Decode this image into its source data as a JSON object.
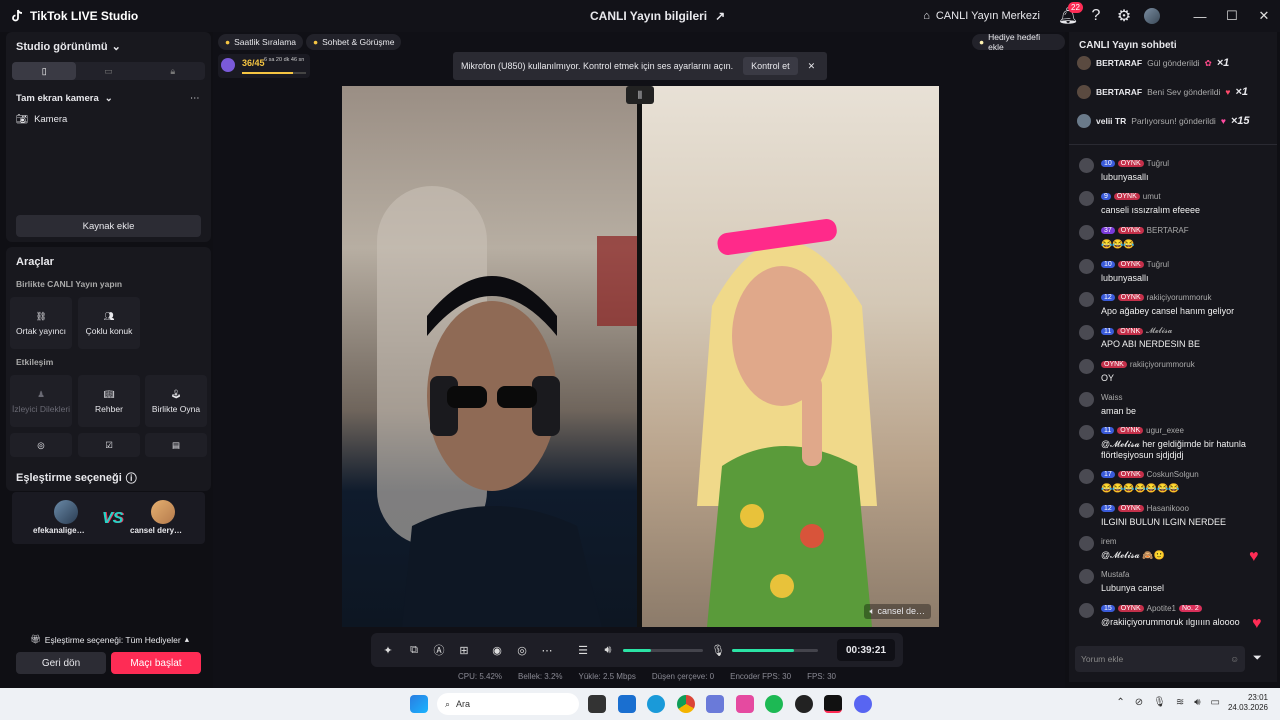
{
  "app": {
    "title": "TikTok LIVE Studio",
    "center_title": "CANLI Yayın bilgileri",
    "hub": "CANLI Yayın Merkezi",
    "notif_count": "22"
  },
  "left": {
    "studio_view": "Studio görünümü",
    "fullscreen_cam": "Tam ekran kamera",
    "camera": "Kamera",
    "add_source": "Kaynak ekle",
    "tools": "Araçlar",
    "live_together": "Birlikte CANLI Yayın yapın",
    "co_host": "Ortak yayıncı",
    "multi_guest": "Çoklu konuk",
    "interaction": "Etkileşim",
    "viewer_wishes": "İzleyici Dilekleri",
    "guide": "Rehber",
    "play_together": "Birlikte Oyna",
    "match_option": "Eşleştirme seçeneği",
    "player1": "efekanalige…",
    "player2": "cansel dery…",
    "vs": "VS",
    "match_gifts": "Eşleştirme seçeneği: Tüm Hediyeler",
    "back": "Geri dön",
    "start_match": "Maçı başlat"
  },
  "center": {
    "chip1": "Saatlik Sıralama",
    "chip2": "Sohbet & Görüşme",
    "chip3": "Hediye hedefi ekle",
    "rank_value": "36/45",
    "rank_time": "6 sa 20 dk 46 sn",
    "rank_progress": 0.8,
    "toast": "Mikrofon (U850) kullanılmıyor. Kontrol etmek için ses ayarlarını açın.",
    "toast_btn": "Kontrol et",
    "right_label": "cansel de…",
    "timer": "00:39:21",
    "volume_level": 0.35,
    "mic_level": 0.72,
    "stats": {
      "cpu": "CPU: 5.42%",
      "mem": "Bellek: 3.2%",
      "upload": "Yükle: 2.5 Mbps",
      "dropped": "Düşen çerçeve: 0",
      "enc": "Encoder FPS: 30",
      "fps": "FPS: 30"
    }
  },
  "chat": {
    "title": "CANLI Yayın sohbeti",
    "gifts": [
      {
        "user": "BERTARAF",
        "text": "Gül gönderildi",
        "count": "×1"
      },
      {
        "user": "BERTARAF",
        "text": "Beni Sev gönderildi",
        "count": "×1"
      },
      {
        "user": "velii TR",
        "text": "Parlıyorsun! gönderildi",
        "count": "×15"
      }
    ],
    "messages": [
      {
        "lvl": "10",
        "user": "Tuğrul",
        "text": "lubunyasallı"
      },
      {
        "lvl": "9",
        "user": "umut",
        "text": "canseli ıssızralım efeeee"
      },
      {
        "lvl": "37",
        "user": "BERTARAF",
        "text": "😂😂😂"
      },
      {
        "lvl": "10",
        "user": "Tuğrul",
        "text": "lubunyasallı"
      },
      {
        "lvl": "12",
        "user": "rakiiçiyorummoruk",
        "text": "Apo ağabey cansel hanım geliyor"
      },
      {
        "lvl": "11",
        "user": "𝓜𝓮𝓵𝓲𝓼𝓪",
        "text": "APO ABI NERDESIN BE"
      },
      {
        "lvl": "",
        "user": "rakiiçiyorummoruk",
        "text": "OY"
      },
      {
        "lvl": "",
        "user": "Waiss",
        "text": "aman be"
      },
      {
        "lvl": "11",
        "user": "ugur_exee",
        "text": "@𝓜𝓮𝓵𝓲𝓼𝓪 her geldiğimde bir hatunla flörtleşiyosun sjdjdjdj"
      },
      {
        "lvl": "17",
        "user": "CoskunSolgun",
        "text": "😂😂😂😂😂😂😂"
      },
      {
        "lvl": "12",
        "user": "Hasanikooo",
        "text": "ILGINI BULUN ILGIN NERDEE"
      },
      {
        "lvl": "",
        "user": "irem",
        "text": "@𝓜𝓮𝓵𝓲𝓼𝓪 🙈🙂"
      },
      {
        "lvl": "",
        "user": "Mustafa",
        "text": "Lubunya cansel"
      },
      {
        "lvl": "15",
        "user": "Apotite1",
        "text": "@rakiiçiyorummoruk ılgıııın aloooo"
      }
    ],
    "oynk": "OYNK",
    "no2": "No. 2",
    "input_placeholder": "Yorum ekle"
  },
  "taskbar": {
    "search": "Ara",
    "time": "23:01",
    "date": "24.03.2026"
  }
}
